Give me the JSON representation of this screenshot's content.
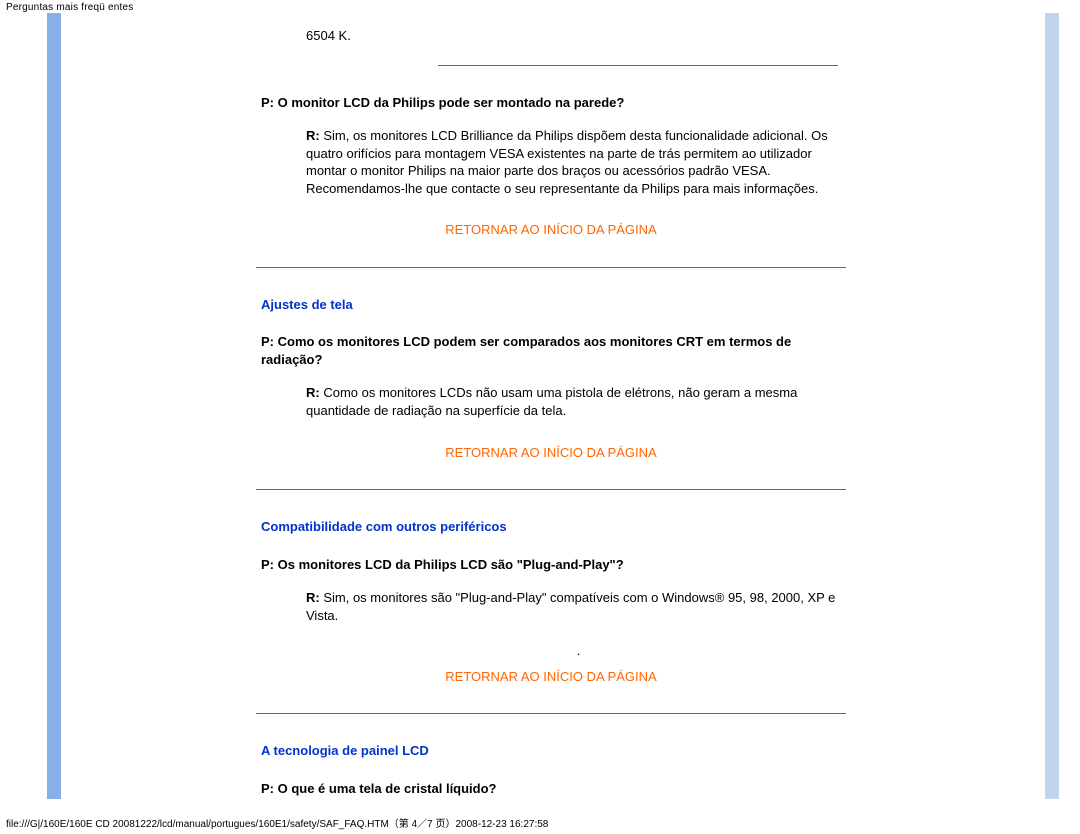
{
  "page_header": "Perguntas mais freqü  entes",
  "prev_answer_tail": "6504 K.",
  "q1_prefix": "P:",
  "q1_text": " O monitor LCD da Philips pode ser montado na parede?",
  "a1_prefix": "R:",
  "a1_text": " Sim, os monitores LCD Brilliance da Philips dispõem desta funcionalidade adicional. Os quatro orifícios para montagem VESA existentes na parte de trás permitem ao utilizador montar o monitor Philips na maior parte dos braços ou acessórios padrão VESA. Recomendamos-lhe que contacte o seu representante da Philips para mais informações.",
  "toplink_label": "RETORNAR AO INÍCIO DA PÁGINA",
  "section2": "Ajustes de tela",
  "q2_prefix": "P:",
  "q2_text": " Como os monitores LCD podem ser comparados aos monitores CRT em termos de radiação?",
  "a2_prefix": "R:",
  "a2_text": " Como os monitores LCDs não usam uma pistola de elétrons, não geram a mesma quantidade de radiação na superfície da tela.",
  "section3": "Compatibilidade com outros periféricos",
  "q3_prefix": "P:",
  "q3_text": " Os monitores LCD da Philips LCD são \"Plug-and-Play\"?",
  "a3_prefix": "R:",
  "a3_text": " Sim, os monitores são \"Plug-and-Play\" compatíveis com o Windows® 95, 98, 2000, XP e Vista.",
  "dot": ".",
  "section4": "A tecnologia de painel LCD",
  "q4_prefix": "P:",
  "q4_text": " O que é uma tela de cristal líquido?",
  "footer_text": "file:///G|/160E/160E CD 20081222/lcd/manual/portugues/160E1/safety/SAF_FAQ.HTM（第 4／7 页）2008-12-23 16:27:58"
}
